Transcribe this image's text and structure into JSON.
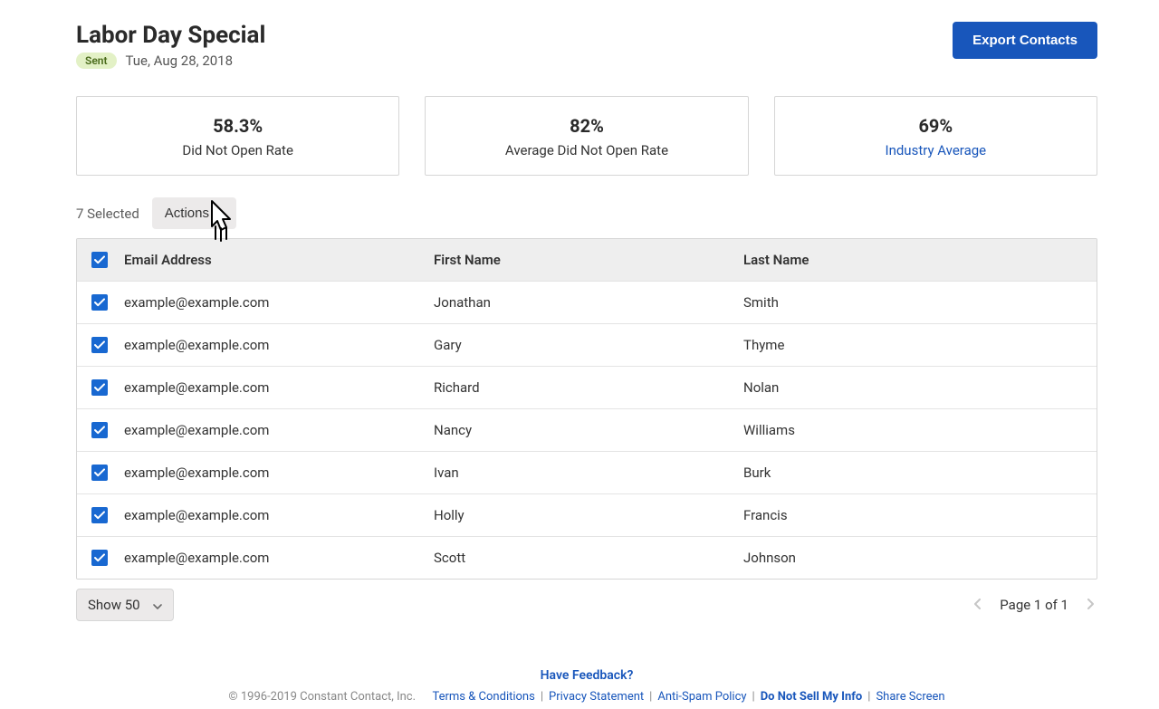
{
  "header": {
    "title": "Labor Day Special",
    "status_badge": "Sent",
    "date": "Tue, Aug 28, 2018",
    "export_button": "Export Contacts"
  },
  "stats": [
    {
      "value": "58.3%",
      "label": "Did Not Open Rate",
      "is_link": false
    },
    {
      "value": "82%",
      "label": "Average Did Not Open Rate",
      "is_link": false
    },
    {
      "value": "69%",
      "label": "Industry Average",
      "is_link": true
    }
  ],
  "selection": {
    "count_text": "7 Selected",
    "actions_label": "Actions"
  },
  "table": {
    "headers": {
      "email": "Email Address",
      "first": "First Name",
      "last": "Last Name"
    },
    "rows": [
      {
        "email": "example@example.com",
        "first": "Jonathan",
        "last": "Smith",
        "checked": true
      },
      {
        "email": "example@example.com",
        "first": "Gary",
        "last": "Thyme",
        "checked": true
      },
      {
        "email": "example@example.com",
        "first": "Richard",
        "last": "Nolan",
        "checked": true
      },
      {
        "email": "example@example.com",
        "first": "Nancy",
        "last": "Williams",
        "checked": true
      },
      {
        "email": "example@example.com",
        "first": "Ivan",
        "last": "Burk",
        "checked": true
      },
      {
        "email": "example@example.com",
        "first": "Holly",
        "last": "Francis",
        "checked": true
      },
      {
        "email": "example@example.com",
        "first": "Scott",
        "last": "Johnson",
        "checked": true
      }
    ]
  },
  "pagination": {
    "show_label": "Show 50",
    "page_text": "Page 1 of 1"
  },
  "footer": {
    "feedback": "Have Feedback?",
    "copyright": "© 1996-2019 Constant Contact, Inc.",
    "links": [
      "Terms & Conditions",
      "Privacy Statement",
      "Anti-Spam Policy",
      "Do Not Sell My Info",
      "Share Screen"
    ]
  }
}
